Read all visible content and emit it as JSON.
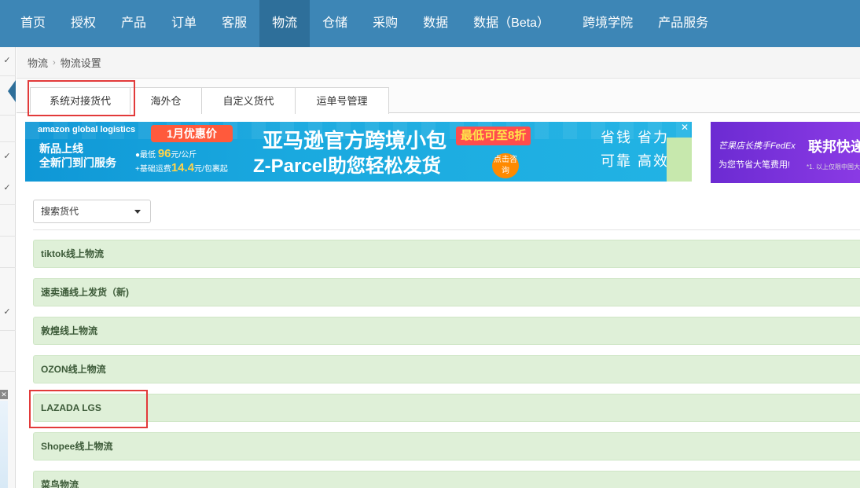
{
  "topnav": {
    "items": [
      "首页",
      "授权",
      "产品",
      "订单",
      "客服",
      "物流",
      "仓储",
      "采购",
      "数据",
      "数据（Beta）",
      "跨境学院",
      "产品服务"
    ],
    "active_index": 5,
    "background_color": "#3d86b6"
  },
  "breadcrumb": {
    "parent": "物流",
    "current": "物流设置"
  },
  "tabs": [
    "系统对接货代",
    "海外仓",
    "自定义货代",
    "运单号管理"
  ],
  "active_tab": "系统对接货代",
  "banner": {
    "brand": "amazon global logistics",
    "line1": "新品上线",
    "line2": "全新门到门服务",
    "promo_pill": "1月优惠价",
    "price1_prefix": "●最低",
    "price1_value": "96",
    "price1_unit": "元/公斤",
    "price2_prefix": "+基础运费",
    "price2_value": "14.4",
    "price2_unit": "元/包裹起",
    "headline": "亚马逊官方跨境小包",
    "discount_tag": "最低可至8折",
    "subheadline": "Z-Parcel助您轻松发货",
    "cta": "点击咨询",
    "right_line1": "省钱 省力",
    "right_line2": "可靠 高效",
    "close": "✕"
  },
  "banner2": {
    "text1": "芒果店长携手FedEx",
    "text2": "联邦快递",
    "text3": "为您节省大笔费用!",
    "text4": "*1. 以上仅限中国大"
  },
  "search": {
    "label": "搜索货代"
  },
  "logistics_list": [
    "tiktok线上物流",
    "速卖通线上发货（新)",
    "敦煌线上物流",
    "OZON线上物流",
    "LAZADA LGS",
    "Shopee线上物流",
    "菜鸟物流"
  ],
  "highlight_color": "#e23a3a",
  "row_color": "#dff0d8"
}
